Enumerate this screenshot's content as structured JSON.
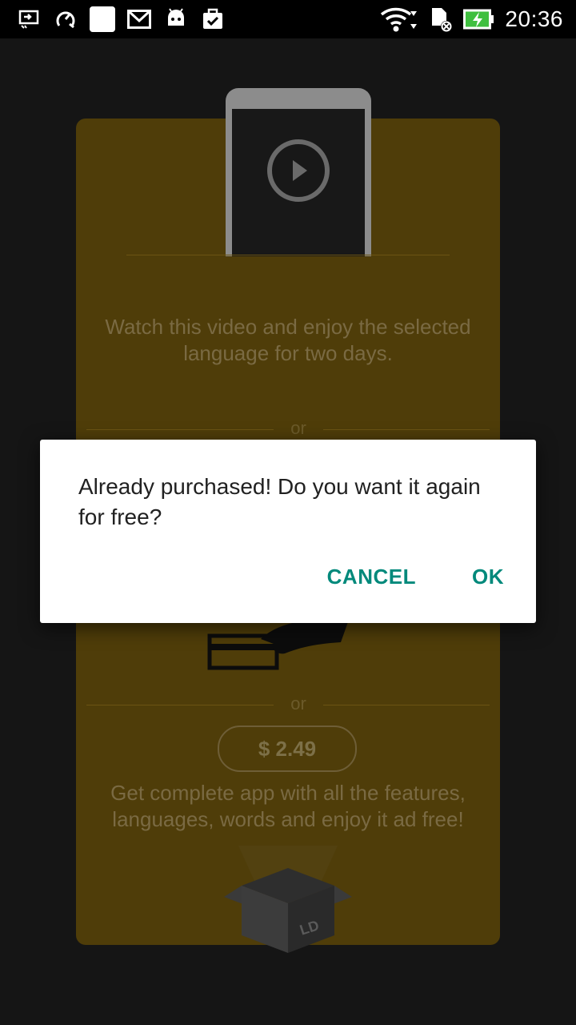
{
  "status_bar": {
    "time": "20:36",
    "left_icons": [
      "cast-screen-icon",
      "speed-test-icon",
      "white-square-icon",
      "gmail-icon",
      "android-icon",
      "clipboard-check-icon"
    ],
    "right_icons": [
      "wifi-icon",
      "sd-card-icon",
      "battery-charging-icon"
    ],
    "battery_color": "#3fbf3f"
  },
  "background": {
    "watch_text": "Watch this video and enjoy the selected language for two days.",
    "or_label_1": "or",
    "or_label_2": "or",
    "price_button": "$ 2.49",
    "get_text": "Get complete app with all the features, languages, words and enjoy it ad free!",
    "box_label": "LD",
    "card_color": "#4f3d09"
  },
  "dialog": {
    "message": "Already purchased! Do you want it again for free?",
    "cancel_label": "CANCEL",
    "ok_label": "OK",
    "accent_color": "#00897b"
  }
}
